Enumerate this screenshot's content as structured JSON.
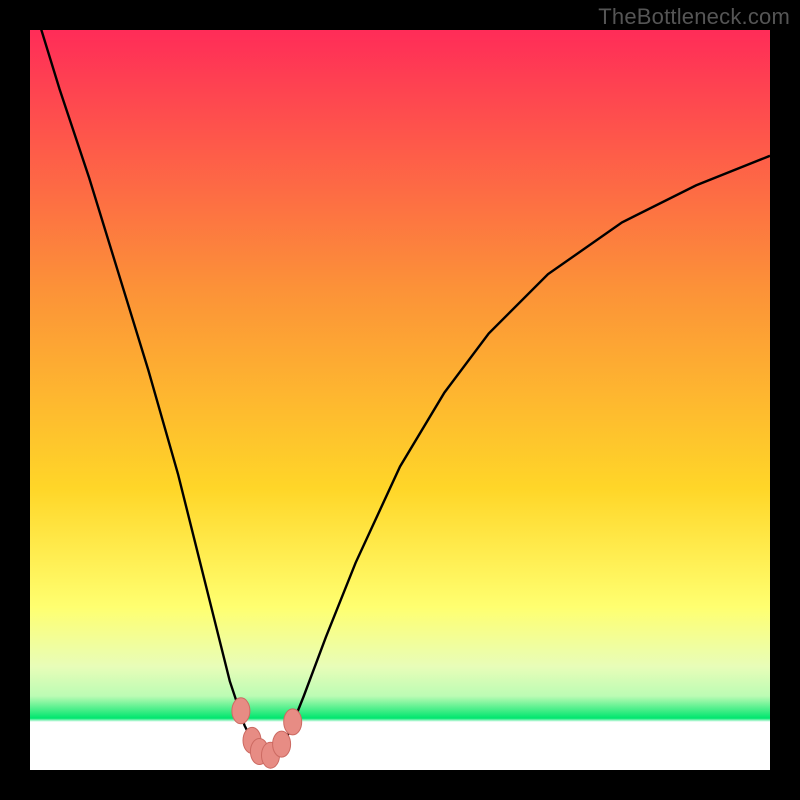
{
  "watermark": "TheBottleneck.com",
  "colors": {
    "frame": "#000000",
    "curve": "#000000",
    "marker_fill": "#E78C84",
    "marker_stroke": "#CC6A62",
    "grad_top": "#FF2C58",
    "grad_mid_upper": "#FC9238",
    "grad_mid": "#FFD628",
    "grad_band_yellow": "#FFFF70",
    "grad_band_light": "#E8FDB8",
    "grad_band_lighter": "#BCFCB4",
    "grad_green": "#00E66E",
    "inner_bottom_white": "#FFFFFF"
  },
  "chart_data": {
    "type": "line",
    "title": "",
    "xlabel": "",
    "ylabel": "",
    "xlim": [
      0,
      100
    ],
    "ylim": [
      0,
      100
    ],
    "series": [
      {
        "name": "bottleneck-curve",
        "x": [
          0,
          4,
          8,
          12,
          16,
          20,
          23,
          25,
          27,
          29,
          30.5,
          32,
          33.5,
          35,
          37,
          40,
          44,
          50,
          56,
          62,
          70,
          80,
          90,
          100
        ],
        "y": [
          105,
          92,
          80,
          67,
          54,
          40,
          28,
          20,
          12,
          6,
          3,
          1.5,
          2.5,
          5,
          10,
          18,
          28,
          41,
          51,
          59,
          67,
          74,
          79,
          83
        ]
      }
    ],
    "markers": {
      "name": "highlight-points",
      "points": [
        {
          "x": 28.5,
          "y": 8
        },
        {
          "x": 30.0,
          "y": 4
        },
        {
          "x": 31.0,
          "y": 2.5
        },
        {
          "x": 32.5,
          "y": 2
        },
        {
          "x": 34.0,
          "y": 3.5
        },
        {
          "x": 35.5,
          "y": 6.5
        }
      ]
    }
  }
}
